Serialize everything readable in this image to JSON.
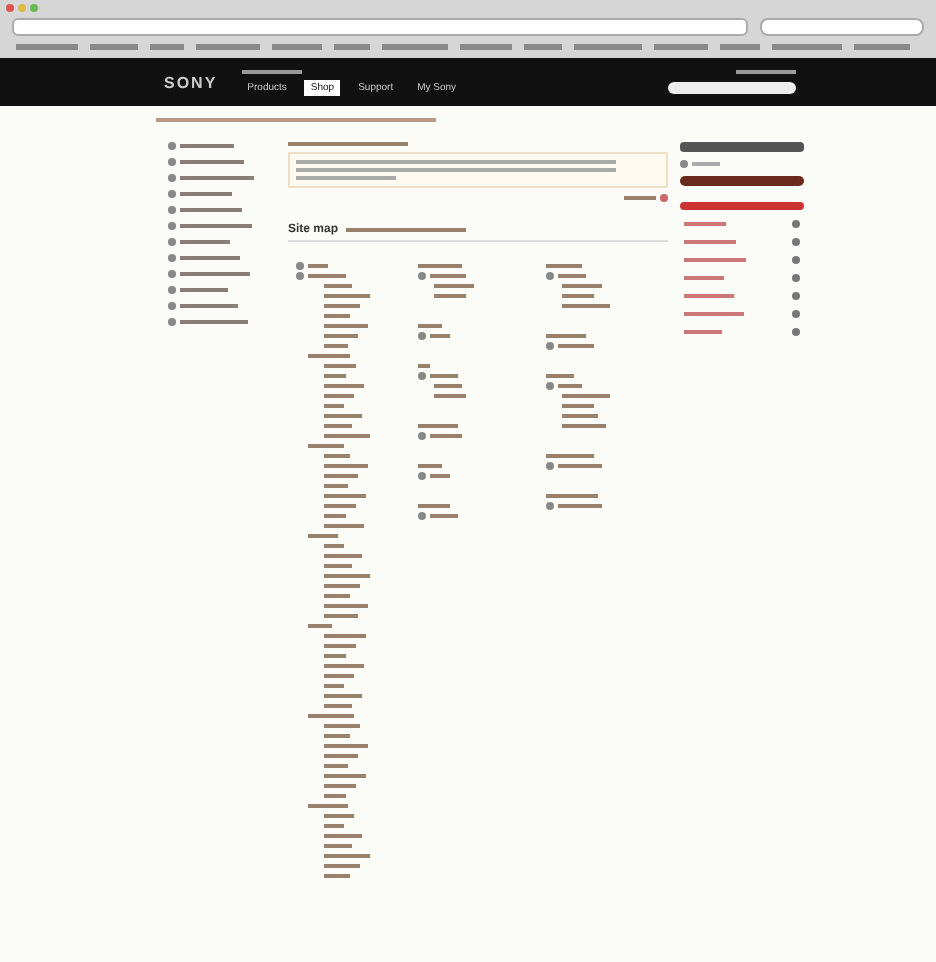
{
  "header": {
    "logo": "SONY",
    "nav": [
      {
        "label": "Products",
        "selected": false
      },
      {
        "label": "Shop",
        "selected": true
      },
      {
        "label": "Support",
        "selected": false
      },
      {
        "label": "My Sony",
        "selected": false
      }
    ]
  },
  "main": {
    "heading": "Site map"
  }
}
